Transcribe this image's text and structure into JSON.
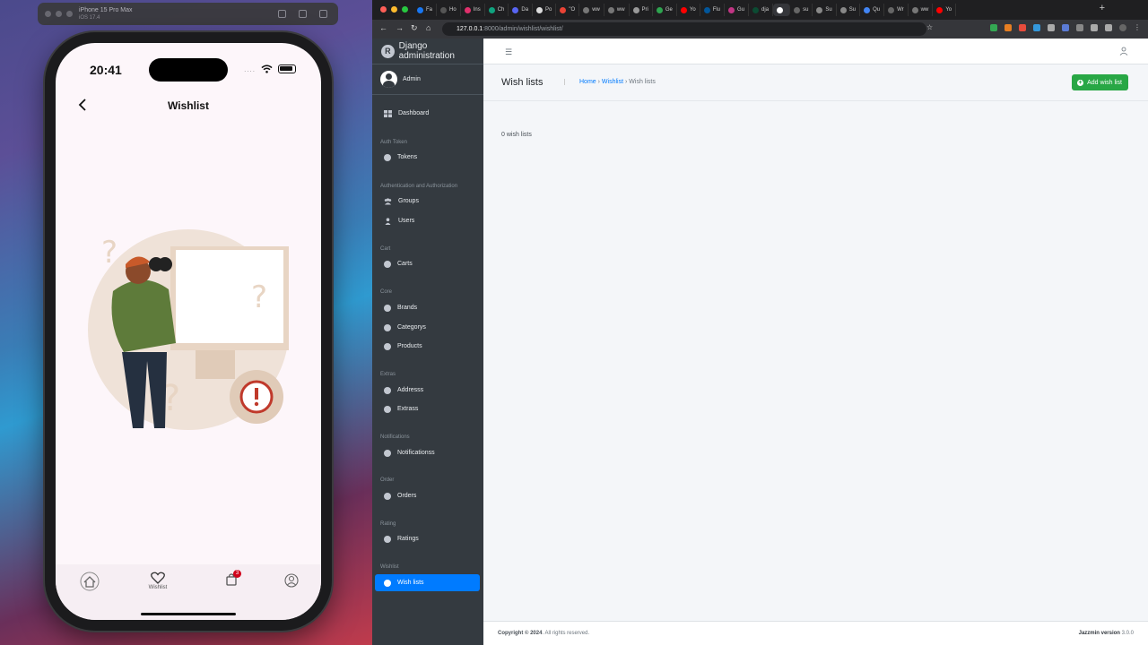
{
  "simulator": {
    "device": "iPhone 15 Pro Max",
    "os": "iOS 17.4"
  },
  "phone": {
    "time": "20:41",
    "signal": "....",
    "title": "Wishlist",
    "tabs": [
      {
        "label": ""
      },
      {
        "label": "Wishlist"
      },
      {
        "label": ""
      },
      {
        "label": ""
      }
    ],
    "cart_badge": "3"
  },
  "browser": {
    "tabs": [
      "Fa",
      "Ho",
      "Ins",
      "Ch",
      "Da",
      "Po",
      "\"O",
      "ww",
      "ww",
      "Pri",
      "Ge",
      "Yo",
      "Flu",
      "Gu",
      "dja",
      "",
      "su",
      "Su",
      "Su",
      "Qu",
      "Wr",
      "ww",
      "Yo"
    ],
    "url_host": "127.0.0.1",
    "url_path": ":8000/admin/wishlist/wishlist/"
  },
  "admin": {
    "brand": "Django administration",
    "user": "Admin",
    "nav": [
      {
        "type": "item",
        "label": "Dashboard",
        "icon": "dashboard-icon"
      },
      {
        "type": "header",
        "label": "Auth Token"
      },
      {
        "type": "item",
        "label": "Tokens",
        "icon": "circle-icon"
      },
      {
        "type": "header",
        "label": "Authentication and Authorization"
      },
      {
        "type": "item",
        "label": "Groups",
        "icon": "users-icon"
      },
      {
        "type": "item",
        "label": "Users",
        "icon": "user-icon"
      },
      {
        "type": "header",
        "label": "Cart"
      },
      {
        "type": "item",
        "label": "Carts",
        "icon": "circle-icon"
      },
      {
        "type": "header",
        "label": "Core"
      },
      {
        "type": "item",
        "label": "Brands",
        "icon": "circle-icon"
      },
      {
        "type": "item",
        "label": "Categorys",
        "icon": "circle-icon"
      },
      {
        "type": "item",
        "label": "Products",
        "icon": "circle-icon"
      },
      {
        "type": "header",
        "label": "Extras"
      },
      {
        "type": "item",
        "label": "Addresss",
        "icon": "circle-icon"
      },
      {
        "type": "item",
        "label": "Extrass",
        "icon": "circle-icon"
      },
      {
        "type": "header",
        "label": "Notifications"
      },
      {
        "type": "item",
        "label": "Notificationss",
        "icon": "circle-icon"
      },
      {
        "type": "header",
        "label": "Order"
      },
      {
        "type": "item",
        "label": "Orders",
        "icon": "circle-icon"
      },
      {
        "type": "header",
        "label": "Rating"
      },
      {
        "type": "item",
        "label": "Ratings",
        "icon": "circle-icon"
      },
      {
        "type": "header",
        "label": "Wishlist"
      },
      {
        "type": "item",
        "label": "Wish lists",
        "icon": "circle-icon",
        "active": true
      }
    ],
    "page_title": "Wish lists",
    "breadcrumb": {
      "home": "Home",
      "section": "Wishlist",
      "current": "Wish lists"
    },
    "add_button": "Add wish list",
    "result_count": "0 wish lists",
    "footer": {
      "copyright_bold": "Copyright © 2024",
      "copyright_rest": ". All rights reserved.",
      "version_label": "Jazzmin version",
      "version": "3.0.0"
    }
  }
}
